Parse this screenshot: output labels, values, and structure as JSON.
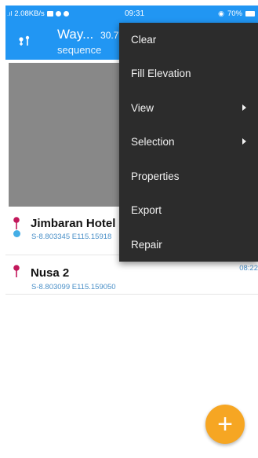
{
  "status_bar": {
    "signal_text": "2.08KB/s",
    "time": "09:31",
    "battery": "70%"
  },
  "toolbar": {
    "title": "Way...",
    "distance": "30.7",
    "subtitle": "sequence",
    "icon": "waypoint-icon"
  },
  "waypoints": [
    {
      "name": "Jimbaran Hotel",
      "coords": "S-8.803345 E115.15918",
      "time": ""
    },
    {
      "name": "Nusa 2",
      "coords": "S-8.803099 E115.159050",
      "time": "08:22"
    }
  ],
  "overflow_menu": {
    "items": [
      {
        "label": "Clear",
        "submenu": false
      },
      {
        "label": "Fill Elevation",
        "submenu": false
      },
      {
        "label": "View",
        "submenu": true
      },
      {
        "label": "Selection",
        "submenu": true
      },
      {
        "label": "Properties",
        "submenu": false
      },
      {
        "label": "Export",
        "submenu": false
      },
      {
        "label": "Repair",
        "submenu": false
      }
    ]
  },
  "fab": {
    "label": "+"
  },
  "colors": {
    "primary": "#2196f3",
    "menu_bg": "#2c2c2c",
    "fab": "#f6a623",
    "pin": "#c2185b",
    "coords": "#4a90c8"
  }
}
